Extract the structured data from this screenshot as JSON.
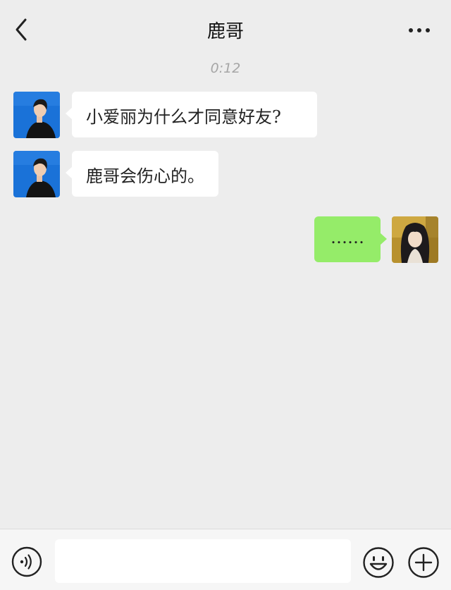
{
  "header": {
    "title": "鹿哥",
    "back_icon": "chevron-left-icon",
    "more_icon": "more-horizontal-icon"
  },
  "chat": {
    "timestamp": "0:12",
    "messages": [
      {
        "side": "in",
        "text": "小爱丽为什么才同意好友?"
      },
      {
        "side": "in",
        "text": "鹿哥会伤心的。"
      },
      {
        "side": "out",
        "text": "……"
      }
    ]
  },
  "input_bar": {
    "voice_icon": "voice-icon",
    "input_value": "",
    "emoji_icon": "emoji-icon",
    "plus_icon": "plus-icon"
  },
  "colors": {
    "background": "#ededed",
    "incoming_bubble": "#ffffff",
    "outgoing_bubble": "#95ec69",
    "contact_avatar_bg": "#1a72d8"
  }
}
